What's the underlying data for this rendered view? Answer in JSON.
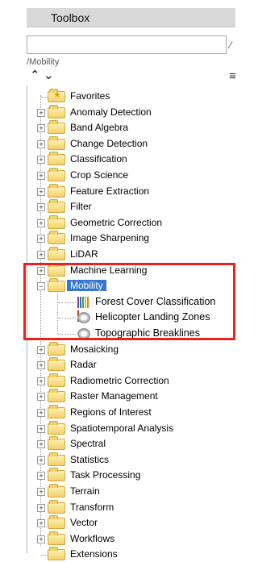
{
  "toolbox": {
    "title": "Toolbox",
    "search_value": "",
    "path": "/Mobility",
    "up_icon": "chevron-up-icon",
    "down_icon": "chevron-down-icon",
    "more_icon": "menu-lines-icon"
  },
  "tree": {
    "items": [
      {
        "label": "Favorites",
        "type": "favorites"
      },
      {
        "label": "Anomaly Detection"
      },
      {
        "label": "Band Algebra"
      },
      {
        "label": "Change Detection"
      },
      {
        "label": "Classification"
      },
      {
        "label": "Crop Science"
      },
      {
        "label": "Feature Extraction"
      },
      {
        "label": "Filter"
      },
      {
        "label": "Geometric Correction"
      },
      {
        "label": "Image Sharpening"
      },
      {
        "label": "LiDAR"
      },
      {
        "label": "Machine Learning"
      },
      {
        "label": "Mobility",
        "expanded": true,
        "selected": true,
        "children": [
          {
            "label": "Forest Cover Classification",
            "icon": "color-bars-icon"
          },
          {
            "label": "Helicopter Landing Zones",
            "icon": "spiral-icon"
          },
          {
            "label": "Topographic Breaklines",
            "icon": "spiral-icon"
          }
        ]
      },
      {
        "label": "Mosaicking"
      },
      {
        "label": "Radar"
      },
      {
        "label": "Radiometric Correction"
      },
      {
        "label": "Raster Management"
      },
      {
        "label": "Regions of Interest"
      },
      {
        "label": "Spatiotemporal Analysis"
      },
      {
        "label": "Spectral"
      },
      {
        "label": "Statistics"
      },
      {
        "label": "Task Processing"
      },
      {
        "label": "Terrain"
      },
      {
        "label": "Transform"
      },
      {
        "label": "Vector"
      },
      {
        "label": "Workflows"
      },
      {
        "label": "Extensions"
      }
    ]
  },
  "colors": {
    "selection": "#3578d0",
    "highlight_box": "#e8231f",
    "folder": "#f2d16a"
  }
}
